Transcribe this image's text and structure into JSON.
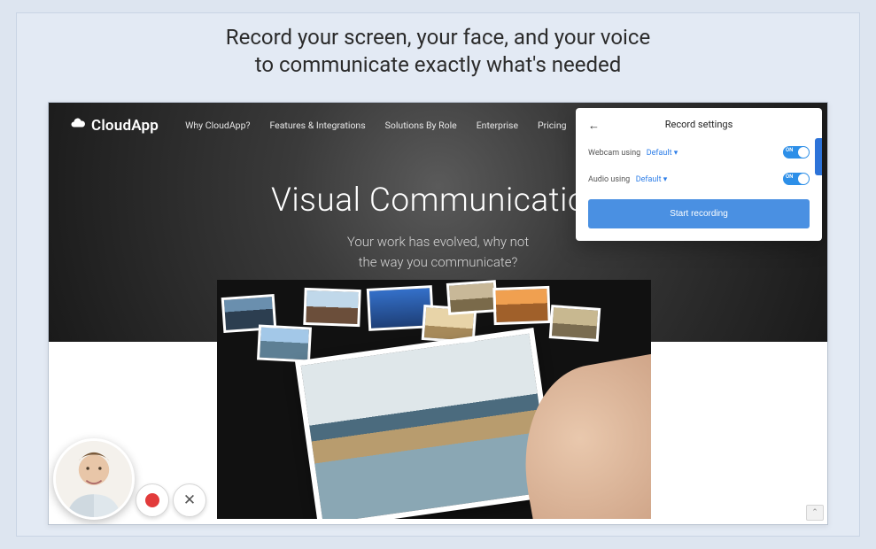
{
  "headline": {
    "line1": "Record your screen, your face, and your voice",
    "line2": "to communicate exactly what's needed"
  },
  "brand": {
    "name": "CloudApp"
  },
  "nav": {
    "items": [
      "Why CloudApp?",
      "Features & Integrations",
      "Solutions By Role",
      "Enterprise",
      "Pricing"
    ]
  },
  "hero": {
    "title": "Visual Communication",
    "sub_line1": "Your work has evolved, why not",
    "sub_line2": "the way you communicate?"
  },
  "panel": {
    "title": "Record settings",
    "webcam_label": "Webcam using",
    "webcam_value": "Default ▾",
    "audio_label": "Audio using",
    "audio_value": "Default ▾",
    "toggle_on": "ON",
    "button": "Start recording"
  },
  "controls": {
    "close_glyph": "✕"
  }
}
